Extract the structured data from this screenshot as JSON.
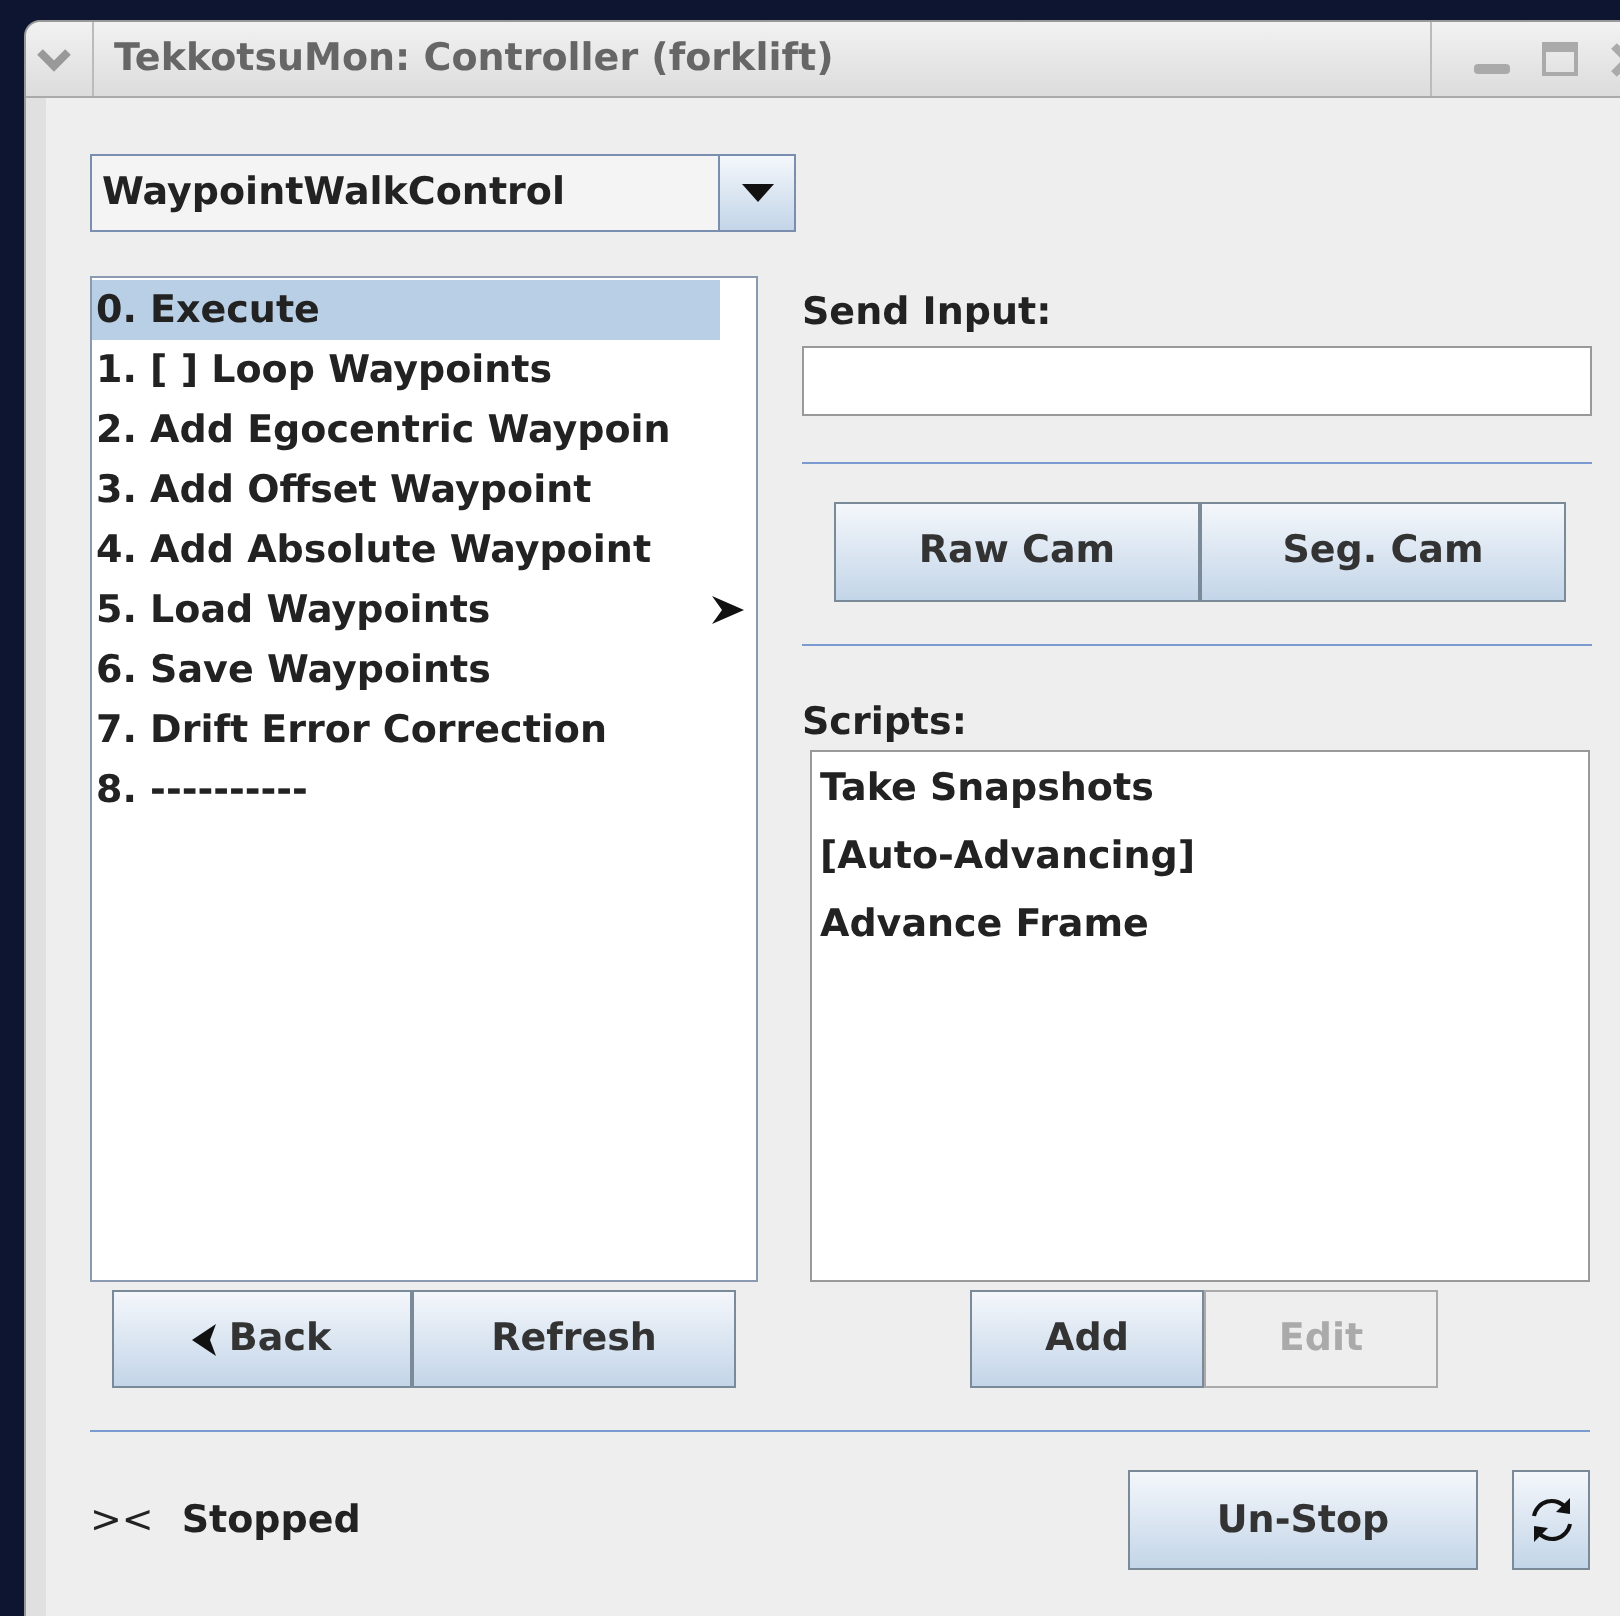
{
  "window": {
    "title": "TekkotsuMon: Controller (forklift)"
  },
  "controller_select": {
    "value": "WaypointWalkControl"
  },
  "menu_items": [
    {
      "label": "0. Execute",
      "selected": true,
      "submenu": false
    },
    {
      "label": "1. [ ] Loop Waypoints",
      "selected": false,
      "submenu": false
    },
    {
      "label": "2. Add Egocentric Waypoin",
      "selected": false,
      "submenu": false
    },
    {
      "label": "3. Add Offset Waypoint",
      "selected": false,
      "submenu": false
    },
    {
      "label": "4. Add Absolute Waypoint",
      "selected": false,
      "submenu": false
    },
    {
      "label": "5. Load Waypoints",
      "selected": false,
      "submenu": true
    },
    {
      "label": "6. Save Waypoints",
      "selected": false,
      "submenu": false
    },
    {
      "label": "7. Drift Error Correction",
      "selected": false,
      "submenu": false
    },
    {
      "label": "8. ----------",
      "selected": false,
      "submenu": false
    }
  ],
  "nav_buttons": [
    {
      "label": "Back",
      "kind": "back",
      "disabled": false
    },
    {
      "label": "Refresh",
      "kind": "plain",
      "disabled": false
    }
  ],
  "send_input": {
    "label": "Send Input:"
  },
  "camera_buttons": [
    {
      "label": "Raw Cam"
    },
    {
      "label": "Seg. Cam"
    }
  ],
  "scripts": {
    "label": "Scripts:",
    "items": [
      "Take Snapshots",
      "[Auto-Advancing]",
      "Advance Frame"
    ]
  },
  "script_buttons": [
    {
      "label": "Add",
      "disabled": false
    },
    {
      "label": "Edit",
      "disabled": true
    }
  ],
  "status": {
    "symbol": "><",
    "text": "Stopped"
  },
  "stop_button": {
    "label": "Un-Stop"
  }
}
